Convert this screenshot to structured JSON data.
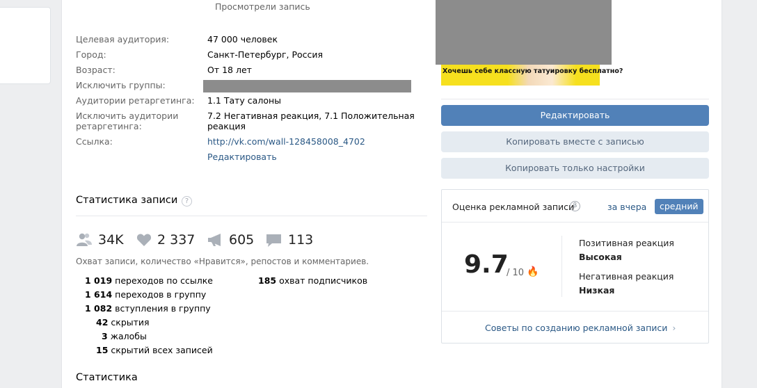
{
  "post": {
    "viewed_caption": "Просмотрели запись"
  },
  "targeting": {
    "rows": [
      {
        "label": "Целевая аудитория:",
        "value": "47 000 человек"
      },
      {
        "label": "Город:",
        "value": "Санкт-Петербург, Россия"
      },
      {
        "label": "Возраст:",
        "value": "От 18 лет"
      },
      {
        "label": "Исключить группы:",
        "value": ""
      },
      {
        "label": "Аудитории ретаргетинга:",
        "value": "1.1 Тату салоны"
      },
      {
        "label": "Исключить аудитории\nретаргетинга:",
        "value": "7.2 Негативная реакция, 7.1 Положительная\nреакция"
      },
      {
        "label": "Ссылка:",
        "value": "http://vk.com/wall-128458008_4702"
      }
    ],
    "edit_link": "Редактировать"
  },
  "ad_preview": {
    "banner_text": "Хочешь себе классную татуировку бесплатно?"
  },
  "post_stats": {
    "title": "Статистика записи",
    "help_icon": "?",
    "reach": "34K",
    "likes": "2 337",
    "reposts": "605",
    "comments": "113",
    "caption": "Охват записи, количество «Нравится», репостов и комментариев.",
    "details_left": [
      {
        "num": "1 019",
        "text": "переходов по ссылке"
      },
      {
        "num": "1 614",
        "text": "переходов в группу"
      },
      {
        "num": "1 082",
        "text": "вступления в группу"
      },
      {
        "num": "42",
        "text": "скрытия"
      },
      {
        "num": "3",
        "text": "жалобы"
      },
      {
        "num": "15",
        "text": "скрытий всех записей"
      }
    ],
    "details_right": [
      {
        "num": "185",
        "text": "охват подписчиков"
      }
    ]
  },
  "stats_section": {
    "title": "Статистика"
  },
  "actions": {
    "edit": "Редактировать",
    "copy_with_post": "Копировать вместе с записью",
    "copy_settings": "Копировать только настройки"
  },
  "rating": {
    "title": "Оценка рекламной записи",
    "beta_badge": "β",
    "tab_yesterday": "за вчера",
    "tab_average": "средний",
    "score": "9.7",
    "score_max": "/ 10",
    "score_emoji": "🔥",
    "positive_label": "Позитивная реакция",
    "positive_value": "Высокая",
    "negative_label": "Негативная реакция",
    "negative_value": "Низкая",
    "tips_link": "Советы по созданию рекламной записи",
    "tips_arrow": "›"
  },
  "colors": {
    "accent": "#5181b8",
    "link": "#2a5885",
    "banner_yellow": "#f6e01e",
    "redaction": "#8c8c8c"
  }
}
